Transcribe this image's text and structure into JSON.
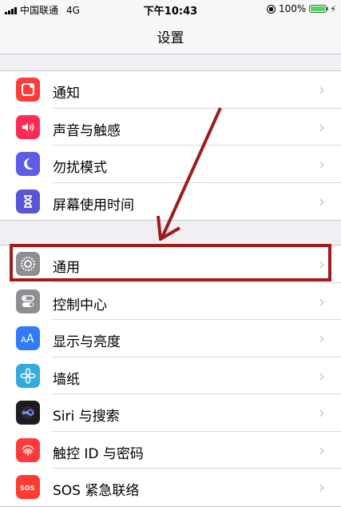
{
  "status": {
    "carrier": "中国联通",
    "network": "4G",
    "time": "下午10:43",
    "battery": "100%",
    "battery_level": 1.0
  },
  "nav": {
    "title": "设置"
  },
  "group1": [
    {
      "label": "通知",
      "icon": "notifications-icon",
      "color": "#fc3d39"
    },
    {
      "label": "声音与触感",
      "icon": "sounds-icon",
      "color": "#fd2b55"
    },
    {
      "label": "勿扰模式",
      "icon": "moon-icon",
      "color": "#5e5ce6"
    },
    {
      "label": "屏幕使用时间",
      "icon": "hourglass-icon",
      "color": "#5856d6"
    }
  ],
  "group2": [
    {
      "label": "通用",
      "icon": "gear-icon",
      "color": "#8e8e93"
    },
    {
      "label": "控制中心",
      "icon": "toggle-icon",
      "color": "#8e8e93"
    },
    {
      "label": "显示与亮度",
      "icon": "text-size-icon",
      "color": "#2f7cf6"
    },
    {
      "label": "墙纸",
      "icon": "flower-icon",
      "color": "#34aadc"
    },
    {
      "label": "Siri 与搜索",
      "icon": "siri-icon",
      "color": "#1c1c1e"
    },
    {
      "label": "触控 ID 与密码",
      "icon": "fingerprint-icon",
      "color": "#fd3b3b"
    },
    {
      "label": "SOS 紧急联络",
      "icon": "sos-icon",
      "color": "#fd3b30"
    }
  ],
  "annotation": {
    "color": "#a01c1c"
  }
}
